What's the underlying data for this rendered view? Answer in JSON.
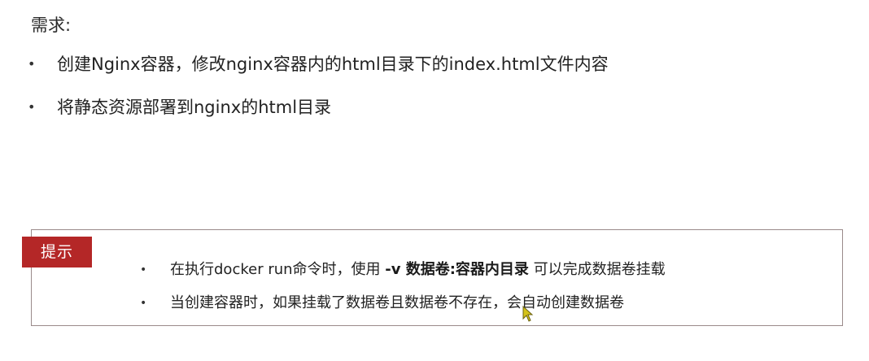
{
  "requirements": {
    "title": "需求:",
    "items": [
      "创建Nginx容器，修改nginx容器内的html目录下的index.html文件内容",
      "将静态资源部署到nginx的html目录"
    ]
  },
  "tip": {
    "label": "提示",
    "items": [
      {
        "before": "在执行docker run命令时，使用 ",
        "emphasis": "-v 数据卷:容器内目录",
        "after": " 可以完成数据卷挂载"
      },
      {
        "before": "当创建容器时，如果挂载了数据卷且数据卷不存在，会自动创建数据卷",
        "emphasis": "",
        "after": ""
      }
    ]
  },
  "bullet_glyph": "•",
  "colors": {
    "tip_label_bg": "#b42727",
    "tip_border": "#9a8a8a",
    "cursor": "#d4c21a"
  },
  "icons": {
    "pointer": "mouse-pointer-icon"
  }
}
